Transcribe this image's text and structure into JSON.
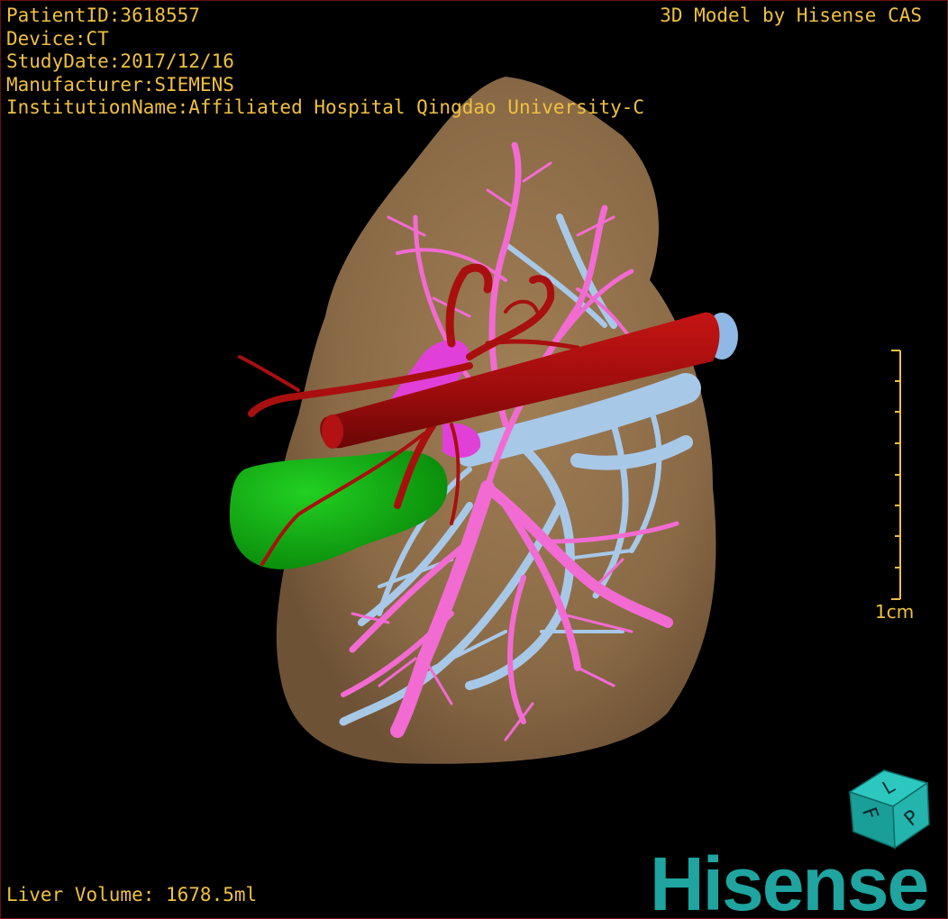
{
  "overlay": {
    "patient_id": "PatientID:3618557",
    "device": "Device:CT",
    "study_date": "StudyDate:2017/12/16",
    "manufacturer": "Manufacturer:SIEMENS",
    "institution": "InstitutionName:Affiliated Hospital Qingdao University-C",
    "credit": "3D Model by Hisense CAS",
    "liver_volume": "Liver Volume: 1678.5ml",
    "scale_unit": "1cm"
  },
  "orientation_cube": {
    "faces": [
      "L",
      "P",
      "F"
    ]
  },
  "brand": {
    "logo_text": "Hisense"
  },
  "colors": {
    "liver": "#8a6a46",
    "hepatic_artery": "#9c0c0c",
    "portal_vein": "#f26bd2",
    "hepatic_vein": "#a8c8e8",
    "gallbladder": "#10a810",
    "overlay_text": "#f0c040",
    "brand": "#1fa4a0"
  }
}
